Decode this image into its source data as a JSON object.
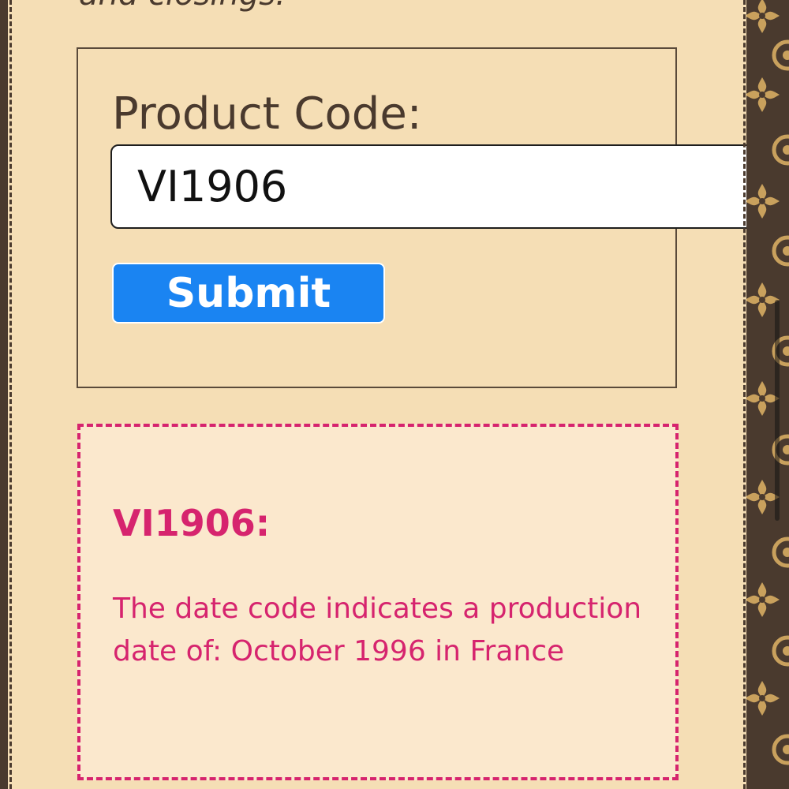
{
  "page": {
    "intro_fragment": "and closings."
  },
  "form": {
    "label": "Product Code:",
    "input_value": "VI1906",
    "submit_label": "Submit"
  },
  "result": {
    "title": "VI1906:",
    "message": "The date code indicates a production date of: October 1996 in France"
  },
  "colors": {
    "background": "#f5deb5",
    "result_background": "#fbe8cd",
    "accent_pink": "#d6246e",
    "button_blue": "#1a84f2",
    "leather_brown": "#4a3a2e",
    "monogram_gold": "#c9a15d"
  },
  "icons": [
    "monogram-flower-icon",
    "monogram-circle-icon"
  ]
}
